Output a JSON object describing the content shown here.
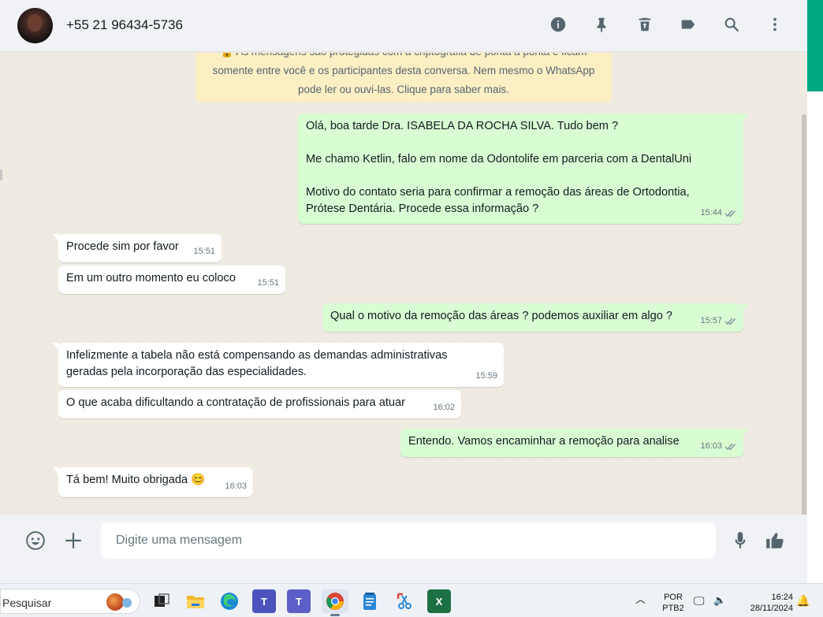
{
  "header": {
    "contact_name": "+55 21 96434-5736",
    "icons": [
      "info-icon",
      "pin-icon",
      "delete-icon",
      "label-icon",
      "search-icon",
      "more-icon"
    ]
  },
  "encryption_notice": {
    "line1": "🔒 As mensagens são protegidas com a criptografia de ponta a ponta e ficam",
    "line2": "somente entre você e os participantes desta conversa. Nem mesmo o WhatsApp",
    "line3": "pode ler ou ouvi-las. Clique para saber mais."
  },
  "messages": [
    {
      "direction": "out",
      "lines": [
        "Olá, boa tarde Dra. ISABELA DA ROCHA SILVA. Tudo bem ?",
        "",
        "Me chamo Ketlin, falo em nome da Odontolife em parceria com a DentalUni",
        "",
        "Motivo do contato seria para confirmar a remoção das áreas de Ortodontia,",
        "Prótese Dentária. Procede essa informação ?"
      ],
      "time": "15:44",
      "status": "read"
    },
    {
      "direction": "in",
      "lines": [
        "Procede sim por favor"
      ],
      "time": "15:51"
    },
    {
      "direction": "in",
      "lines": [
        "Em um outro momento eu coloco"
      ],
      "time": "15:51"
    },
    {
      "direction": "out",
      "lines": [
        "Qual o motivo da remoção das áreas ? podemos auxiliar em algo ?"
      ],
      "time": "15:57",
      "status": "read"
    },
    {
      "direction": "in",
      "lines": [
        "Infelizmente a tabela não está compensando as demandas administrativas",
        "geradas pela incorporação das especialidades."
      ],
      "time": "15:59"
    },
    {
      "direction": "in",
      "lines": [
        "O que acaba dificultando a contratação de profissionais para atuar"
      ],
      "time": "16:02"
    },
    {
      "direction": "out",
      "lines": [
        "Entendo. Vamos encaminhar a remoção para analise"
      ],
      "time": "16:03",
      "status": "read"
    },
    {
      "direction": "in",
      "lines": [
        "Tá bem! Muito obrigada 😊"
      ],
      "time": "16:03"
    }
  ],
  "composer": {
    "placeholder": "Digite uma mensagem",
    "value": ""
  },
  "taskbar": {
    "search_placeholder": "Pesquisar",
    "apps": [
      {
        "name": "task-view",
        "label": ""
      },
      {
        "name": "file-explorer",
        "label": ""
      },
      {
        "name": "edge",
        "label": ""
      },
      {
        "name": "teams",
        "label": "T"
      },
      {
        "name": "teams-classic",
        "label": "T"
      },
      {
        "name": "chrome",
        "label": ""
      },
      {
        "name": "notepad",
        "label": ""
      },
      {
        "name": "snipping-tool",
        "label": ""
      },
      {
        "name": "excel",
        "label": "X"
      }
    ],
    "language_line1": "POR",
    "language_line2": "PTB2",
    "time": "16:24",
    "date": "28/11/2024"
  },
  "colors": {
    "accent": "#00a884",
    "outgoing_bubble": "#d9fdd3",
    "incoming_bubble": "#ffffff",
    "read_ticks": "#53bdeb",
    "encryption_bg": "#fcefc4"
  }
}
